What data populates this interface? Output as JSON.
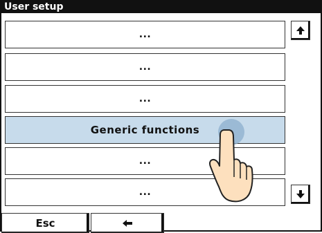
{
  "window": {
    "title": "User setup"
  },
  "menu": {
    "items": [
      {
        "label": "...",
        "selected": false
      },
      {
        "label": "...",
        "selected": false
      },
      {
        "label": "...",
        "selected": false
      },
      {
        "label": "Generic functions",
        "selected": true
      },
      {
        "label": "...",
        "selected": false
      },
      {
        "label": "...",
        "selected": false
      }
    ]
  },
  "scroll": {
    "up_icon": "arrow-up-icon",
    "down_icon": "arrow-down-icon"
  },
  "footer": {
    "esc_label": "Esc",
    "back_icon": "arrow-left-icon"
  },
  "overlay": {
    "touch_icon": "pointing-hand-icon"
  },
  "colors": {
    "selected_bg": "#c7dbeb",
    "title_bg": "#111111",
    "touch_dot": "#8cafcd"
  }
}
